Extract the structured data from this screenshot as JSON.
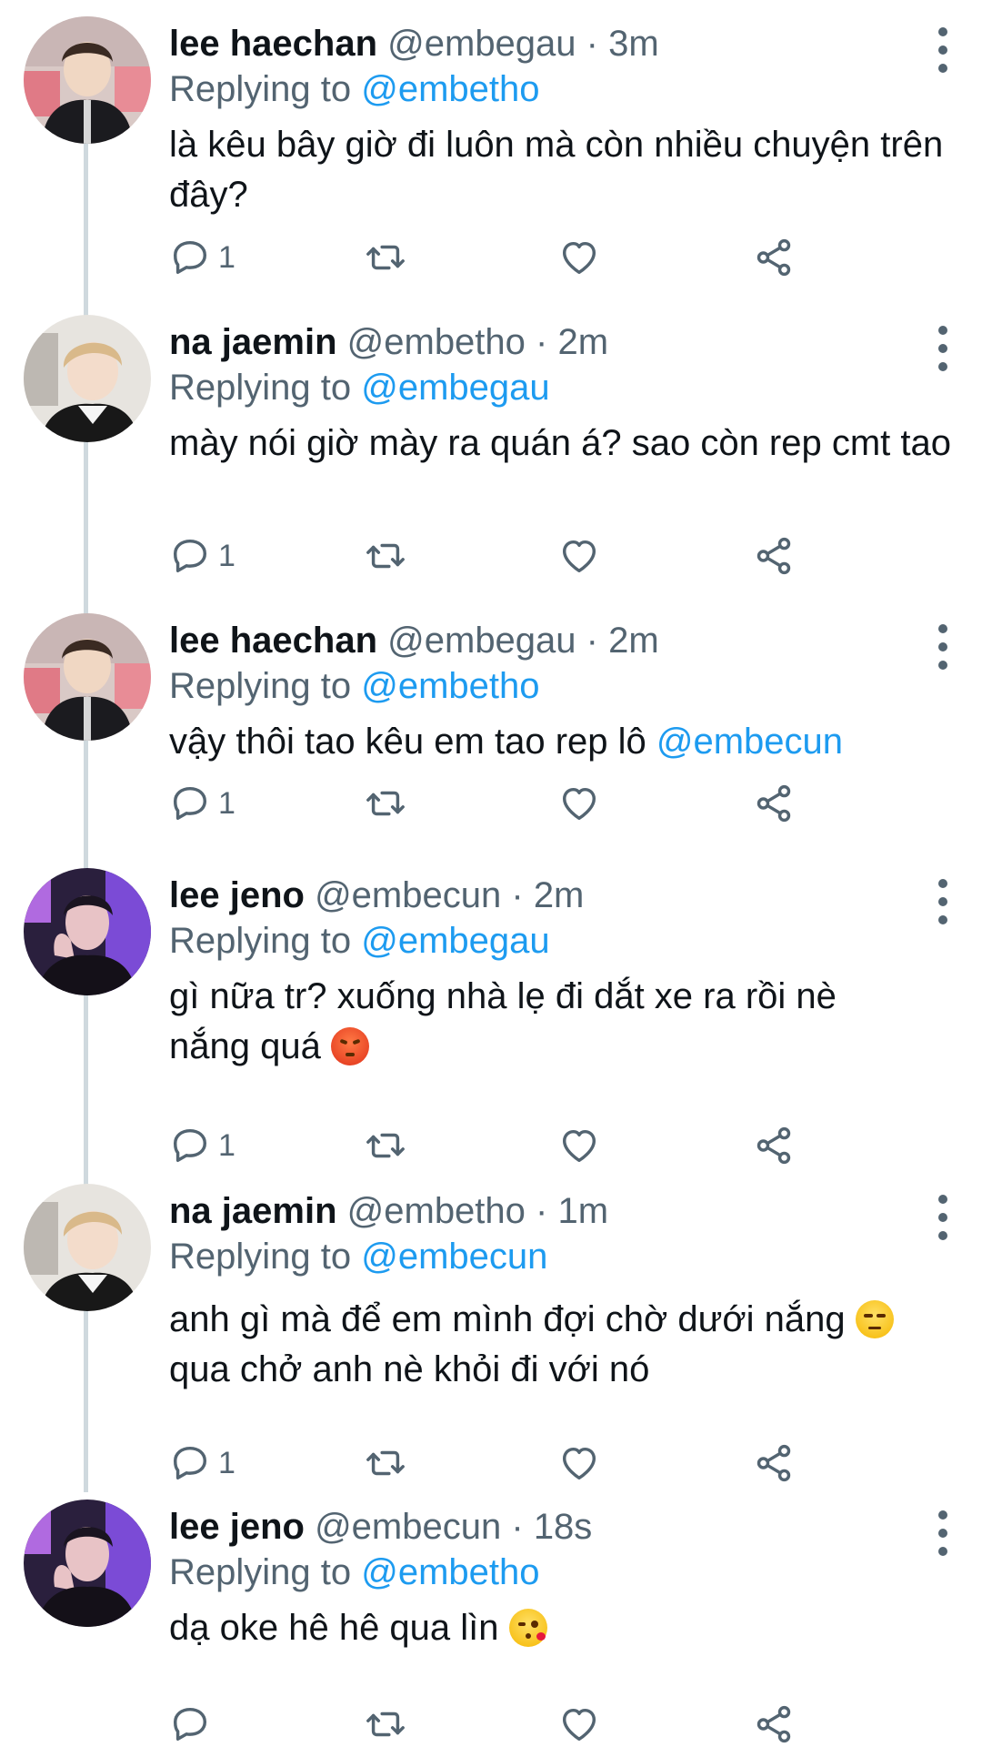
{
  "tweets": [
    {
      "name": "lee haechan",
      "handle": "@embegau",
      "time": "3m",
      "replying_prefix": "Replying to",
      "replying_to": "@embetho",
      "text": "là kêu bây giờ đi luôn mà còn nhiều chuyện trên đây?",
      "reply_count": "1",
      "avatar_style": "haechan"
    },
    {
      "name": "na jaemin",
      "handle": "@embetho",
      "time": "2m",
      "replying_prefix": "Replying to",
      "replying_to": "@embegau",
      "text": "mày nói giờ mày ra quán á? sao còn rep cmt tao",
      "reply_count": "1",
      "avatar_style": "jaemin"
    },
    {
      "name": "lee haechan",
      "handle": "@embegau",
      "time": "2m",
      "replying_prefix": "Replying to",
      "replying_to": "@embetho",
      "text": "vậy thôi tao kêu em tao rep lô",
      "text_mention": "@embecun",
      "reply_count": "1",
      "avatar_style": "haechan"
    },
    {
      "name": "lee jeno",
      "handle": "@embecun",
      "time": "2m",
      "replying_prefix": "Replying to",
      "replying_to": "@embegau",
      "text_line1": "gì nữa tr? xuống nhà lẹ đi dắt xe ra rồi nè",
      "text_line2": "nắng quá",
      "emoji": "angry-face-emoji",
      "reply_count": "1",
      "avatar_style": "jeno"
    },
    {
      "name": "na jaemin",
      "handle": "@embetho",
      "time": "1m",
      "replying_prefix": "Replying to",
      "replying_to": "@embecun",
      "text_line1": "anh gì mà để em mình đợi chờ dưới nắng",
      "text_line2": "qua chở anh nè khỏi đi với nó",
      "emoji": "unamused-face-emoji",
      "reply_count": "1",
      "avatar_style": "jaemin"
    },
    {
      "name": "lee jeno",
      "handle": "@embecun",
      "time": "18s",
      "replying_prefix": "Replying to",
      "replying_to": "@embetho",
      "text": "dạ oke hê hê qua lìn",
      "emoji": "kissing-face-emoji",
      "reply_count": "",
      "avatar_style": "jeno"
    }
  ],
  "separator": "·",
  "icons": {
    "reply": "reply-icon",
    "retweet": "retweet-icon",
    "like": "like-icon",
    "share": "share-icon",
    "more": "more-options-icon"
  },
  "colors": {
    "mention": "#1d9bf0",
    "secondary_text": "#536471",
    "thread_line": "#cfd9de"
  }
}
